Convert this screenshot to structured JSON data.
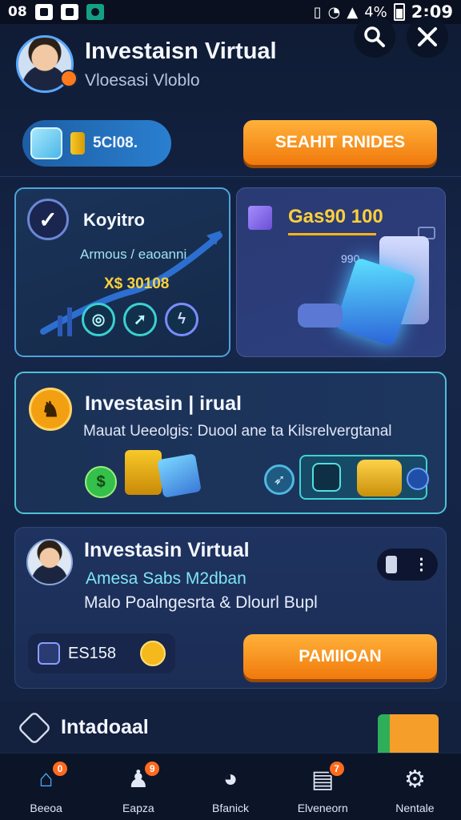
{
  "status_bar": {
    "left_text": "08",
    "battery": "4%",
    "time": "2:09"
  },
  "header": {
    "title": "Investaisn Virtual",
    "subtitle": "Vloesasi Vloblo",
    "search_icon": "search-icon",
    "close_icon": "close-icon"
  },
  "wallet": {
    "amount": "5Cl08."
  },
  "top_button": {
    "label": "SEAHIT RNIDES"
  },
  "card_a": {
    "title": "Koyitro",
    "subtitle": "Armous / eaoanni",
    "value": "X$ 30108",
    "icons": [
      "target-icon",
      "rocket-icon",
      "lightning-icon"
    ]
  },
  "card_b": {
    "title": "Gas90 100",
    "small": "990"
  },
  "card_c": {
    "title": "Investasin | irual",
    "description": "Mauat Ueeolgis: Duool ane ta Kilsrelvergtanal",
    "dollar_symbol": "$"
  },
  "card_d": {
    "title": "Investasin Virtual",
    "subtitle": "Amesa Sabs M2dban",
    "description": "Malo Poalngesrta & Dlourl Bupl",
    "left_value": "ES158",
    "button_label": "PAMIIOAN"
  },
  "peek": {
    "title": "Intadoaal"
  },
  "bottom_nav": {
    "items": [
      {
        "label": "Beeoa",
        "icon": "home-icon",
        "badge": "0"
      },
      {
        "label": "Eapza",
        "icon": "person-icon",
        "badge": "9"
      },
      {
        "label": "Bfanick",
        "icon": "handshake-icon",
        "badge": ""
      },
      {
        "label": "Elveneorn",
        "icon": "chart-icon",
        "badge": "7"
      },
      {
        "label": "Nentale",
        "icon": "gear-icon",
        "badge": ""
      }
    ]
  },
  "colors": {
    "background": "#15264a",
    "accent_orange": "#f07a0c",
    "accent_cyan": "#4fc0d6",
    "gold": "#ffd23c"
  }
}
